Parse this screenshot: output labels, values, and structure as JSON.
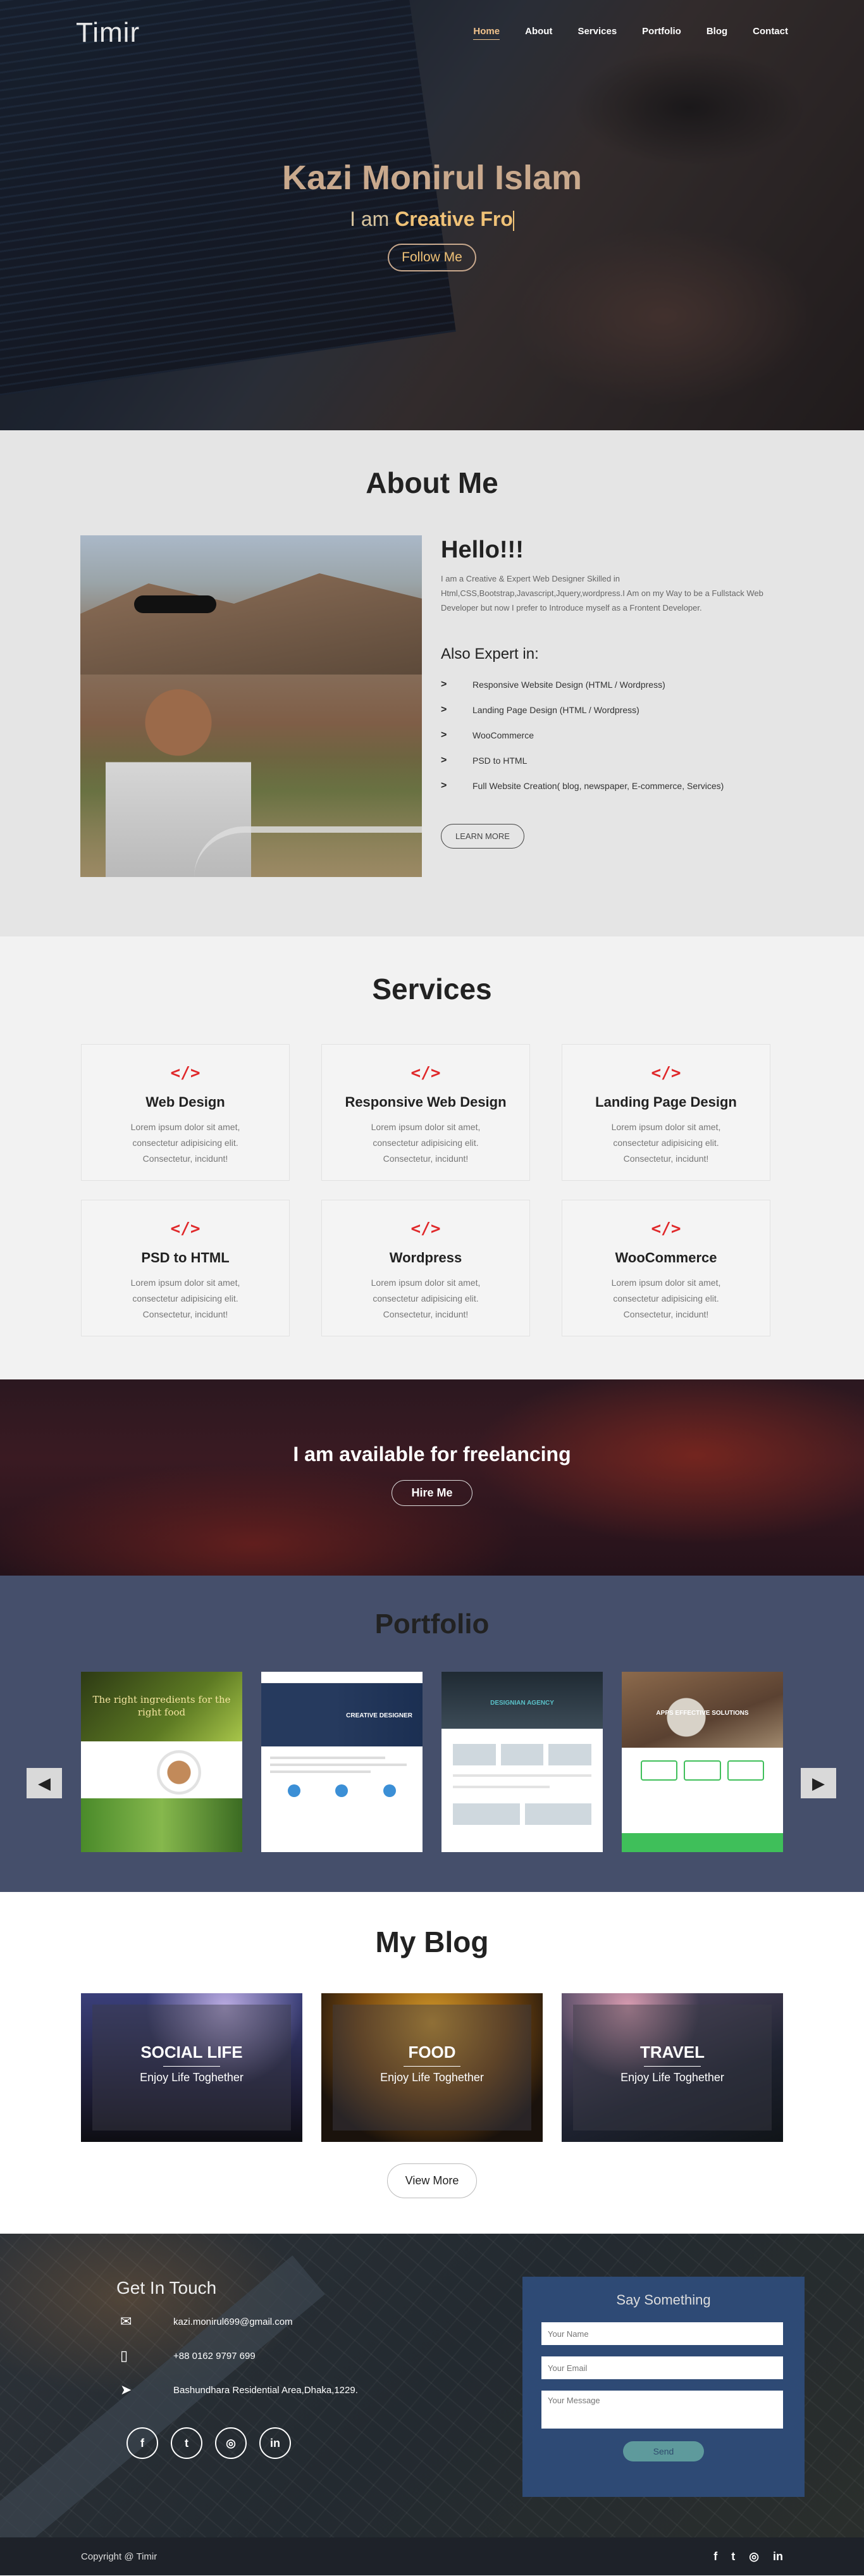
{
  "header": {
    "logo": "Timir",
    "nav": [
      "Home",
      "About",
      "Services",
      "Portfolio",
      "Blog",
      "Contact"
    ]
  },
  "hero": {
    "name": "Kazi Monirul Islam",
    "role_prefix": "I am ",
    "role_typed": "Creative Fro",
    "button": "Follow Me"
  },
  "about": {
    "title": "About Me",
    "greeting": "Hello!!!",
    "bio": "I am a Creative & Expert Web Designer Skilled in Html,CSS,Bootstrap,Javascript,Jquery,wordpress.I Am on my Way to be a Fullstack Web Developer but now I prefer to Introduce myself as a Frontent Developer.",
    "expert_title": "Also Expert in:",
    "skills": [
      "Responsive Website Design (HTML / Wordpress)",
      "Landing Page Design (HTML / Wordpress)",
      "WooCommerce",
      "PSD to HTML",
      "Full Website Creation( blog, newspaper, E-commerce, Services)"
    ],
    "button": "LEARN MORE"
  },
  "services": {
    "title": "Services",
    "icon_glyph": "</>",
    "items": [
      {
        "title": "Web Design",
        "desc": "Lorem ipsum dolor sit amet, consectetur adipisicing elit. Consectetur, incidunt!"
      },
      {
        "title": "Responsive Web Design",
        "desc": "Lorem ipsum dolor sit amet, consectetur adipisicing elit. Consectetur, incidunt!"
      },
      {
        "title": "Landing Page Design",
        "desc": "Lorem ipsum dolor sit amet, consectetur adipisicing elit. Consectetur, incidunt!"
      },
      {
        "title": "PSD to HTML",
        "desc": "Lorem ipsum dolor sit amet, consectetur adipisicing elit. Consectetur, incidunt!"
      },
      {
        "title": "Wordpress",
        "desc": "Lorem ipsum dolor sit amet, consectetur adipisicing elit. Consectetur, incidunt!"
      },
      {
        "title": "WooCommerce",
        "desc": "Lorem ipsum dolor sit amet, consectetur adipisicing elit. Consectetur, incidunt!"
      }
    ]
  },
  "freelance": {
    "title": "I am available for freelancing",
    "button": "Hire Me"
  },
  "portfolio": {
    "title": "Portfolio",
    "card1_text": "The right ingredients for the right food",
    "card2_text": "CREATIVE DESIGNER",
    "card3_text": "DESIGNIAN AGENCY",
    "card4_text": "APPS EFFECTIVE SOLUTIONS"
  },
  "blog": {
    "title": "My Blog",
    "cards": [
      {
        "title": "SOCIAL LIFE",
        "subtitle": "Enjoy Life Toghether"
      },
      {
        "title": "FOOD",
        "subtitle": "Enjoy Life Toghether"
      },
      {
        "title": "TRAVEL",
        "subtitle": "Enjoy Life Toghether"
      }
    ],
    "button": "View More"
  },
  "contact": {
    "title": "Get In Touch",
    "email": "kazi.monirul699@gmail.com",
    "phone": "+88 0162 9797 699",
    "address": "Bashundhara Residential Area,Dhaka,1229.",
    "form_title": "Say Something",
    "name_placeholder": "Your Name",
    "email_placeholder": "Your Email",
    "message_placeholder": "Your Message",
    "send": "Send"
  },
  "footer": {
    "copyright": "Copyright @ Timir"
  },
  "icons": {
    "facebook": "f",
    "twitter": "t",
    "instagram": "◎",
    "linkedin": "in",
    "email": "✉",
    "phone": "▯",
    "location": "➤",
    "prev": "◀",
    "next": "▶"
  },
  "colors": {
    "accent": "#f0c277",
    "service_icon": "#e0282a",
    "portfolio_bg": "#454f6b",
    "form_bg": "#2e4a75",
    "footer_bg": "#1e2229"
  }
}
